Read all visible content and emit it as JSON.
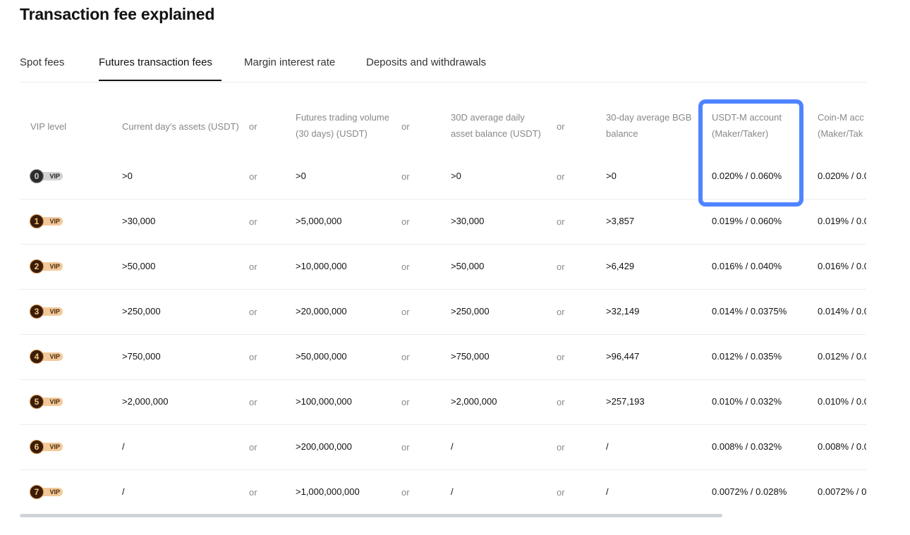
{
  "page": {
    "title": "Transaction fee explained"
  },
  "tabs": [
    {
      "label": "Spot fees"
    },
    {
      "label": "Futures transaction fees"
    },
    {
      "label": "Margin interest rate"
    },
    {
      "label": "Deposits and withdrawals"
    }
  ],
  "active_tab": "Futures transaction fees",
  "table": {
    "headers": {
      "vip": "VIP level",
      "assets": "Current day's assets (USDT)",
      "or": "or",
      "volume_line1": "Futures trading volume",
      "volume_line2": "(30 days) (USDT)",
      "avg_balance_line1": "30D average daily",
      "avg_balance_line2": "asset balance (USDT)",
      "bgb_line1": "30-day average BGB",
      "bgb_line2": "balance",
      "usdtm_line1": "USDT-M account",
      "usdtm_line2": "(Maker/Taker)",
      "coinm_line1": "Coin-M acc",
      "coinm_line2": "(Maker/Tak"
    },
    "vip_badge_text": "VIP",
    "rows": [
      {
        "level": "0",
        "assets": ">0",
        "volume": ">0",
        "avg_balance": ">0",
        "bgb": ">0",
        "usdtm": "0.020% / 0.060%",
        "coinm": "0.020% / 0.0"
      },
      {
        "level": "1",
        "assets": ">30,000",
        "volume": ">5,000,000",
        "avg_balance": ">30,000",
        "bgb": ">3,857",
        "usdtm": "0.019% / 0.060%",
        "coinm": "0.019% / 0.0"
      },
      {
        "level": "2",
        "assets": ">50,000",
        "volume": ">10,000,000",
        "avg_balance": ">50,000",
        "bgb": ">6,429",
        "usdtm": "0.016% / 0.040%",
        "coinm": "0.016% / 0.0"
      },
      {
        "level": "3",
        "assets": ">250,000",
        "volume": ">20,000,000",
        "avg_balance": ">250,000",
        "bgb": ">32,149",
        "usdtm": "0.014% / 0.0375%",
        "coinm": "0.014% / 0.0"
      },
      {
        "level": "4",
        "assets": ">750,000",
        "volume": ">50,000,000",
        "avg_balance": ">750,000",
        "bgb": ">96,447",
        "usdtm": "0.012% / 0.035%",
        "coinm": "0.012% / 0.0"
      },
      {
        "level": "5",
        "assets": ">2,000,000",
        "volume": ">100,000,000",
        "avg_balance": ">2,000,000",
        "bgb": ">257,193",
        "usdtm": "0.010% / 0.032%",
        "coinm": "0.010% / 0.0"
      },
      {
        "level": "6",
        "assets": "/",
        "volume": ">200,000,000",
        "avg_balance": "/",
        "bgb": "/",
        "usdtm": "0.008% / 0.032%",
        "coinm": "0.008% / 0.0"
      },
      {
        "level": "7",
        "assets": "/",
        "volume": ">1,000,000,000",
        "avg_balance": "/",
        "bgb": "/",
        "usdtm": "0.0072% / 0.028%",
        "coinm": "0.0072% / 0"
      }
    ]
  },
  "colors": {
    "highlight": "#4f84ff",
    "vip_pill": "#f2c99a",
    "vip_circle": "#3a1c08",
    "muted_text": "#888888"
  }
}
